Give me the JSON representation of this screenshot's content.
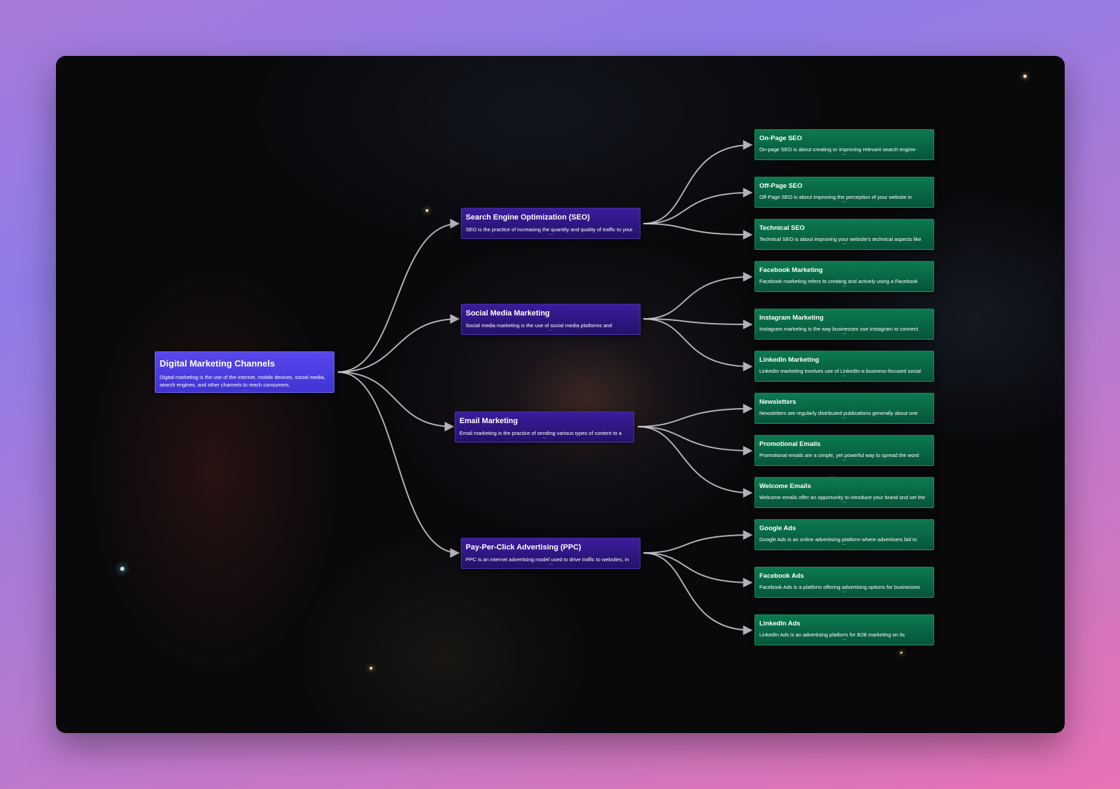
{
  "root": {
    "title": "Digital Marketing Channels",
    "desc": "Digital marketing is the use of the internet, mobile devices, social media, search engines, and other channels to reach consumers.",
    "more": "..."
  },
  "branches": [
    {
      "title": "Search Engine Optimization (SEO)",
      "desc": "SEO is the practice of increasing the quantity and quality of traffic to your",
      "more": "..."
    },
    {
      "title": "Social Media Marketing",
      "desc": "Social media marketing is the use of social media platforms and",
      "more": "..."
    },
    {
      "title": "Email Marketing",
      "desc": "Email marketing is the practice of sending various types of content to a",
      "more": "..."
    },
    {
      "title": "Pay-Per-Click Advertising (PPC)",
      "desc": "PPC is an internet advertising model used to drive traffic to websites, in",
      "more": "..."
    }
  ],
  "leaves": [
    {
      "title": "On-Page SEO",
      "desc": "On-page SEO is about creating or improving relevant search engine-",
      "more": "..."
    },
    {
      "title": "Off-Page SEO",
      "desc": "Off-Page SEO is about improving the perception of your website in",
      "more": "..."
    },
    {
      "title": "Technical SEO",
      "desc": "Technical SEO is about improving your website's technical aspects like",
      "more": "..."
    },
    {
      "title": "Facebook Marketing",
      "desc": "Facebook marketing refers to creating and actively using a Facebook",
      "more": "..."
    },
    {
      "title": "Instagram Marketing",
      "desc": "Instagram marketing is the way businesses use Instagram to connect",
      "more": "..."
    },
    {
      "title": "LinkedIn Marketing",
      "desc": "LinkedIn marketing involves use of LinkedIn-a business-focused social",
      "more": "..."
    },
    {
      "title": "Newsletters",
      "desc": "Newsletters are regularly distributed publications generally about one",
      "more": "..."
    },
    {
      "title": "Promotional Emails",
      "desc": "Promotional emails are a simple, yet powerful way to spread the word",
      "more": "..."
    },
    {
      "title": "Welcome Emails",
      "desc": "Welcome emails offer an opportunity to introduce your brand and set the",
      "more": "..."
    },
    {
      "title": "Google Ads",
      "desc": "Google Ads is an online advertising platform where advertisers bid to",
      "more": "..."
    },
    {
      "title": "Facebook Ads",
      "desc": "Facebook Ads is a platform offering advertising options for businesses",
      "more": "..."
    },
    {
      "title": "LinkedIn Ads",
      "desc": "LinkedIn Ads is an advertising platform for B2B marketing on its",
      "more": "..."
    }
  ],
  "colors": {
    "root": "#4a3ee0",
    "branch": "#2c158a",
    "leaf": "#0a6b46",
    "link": "#cfcfd6"
  }
}
